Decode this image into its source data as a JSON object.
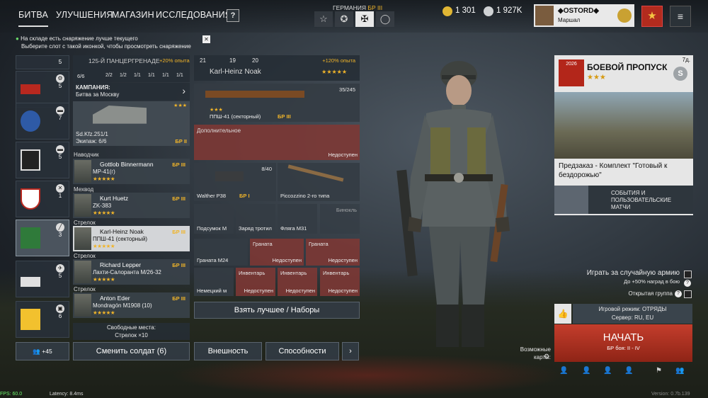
{
  "nav": {
    "tabs": [
      "БИТВА",
      "УЛУЧШЕНИЯ",
      "МАГАЗИН",
      "ИССЛЕДОВАНИЯ"
    ],
    "help": "?"
  },
  "nation": {
    "label": "ГЕРМАНИЯ",
    "br": "БР III",
    "buttons": [
      "☆",
      "✪",
      "✠",
      "◯"
    ]
  },
  "currency": {
    "gold": "1 301",
    "silver": "1 927K"
  },
  "profile": {
    "name": "◆OSTORD◆",
    "rank": "Маршал"
  },
  "notice": {
    "line1": "На складе есть снаряжение лучше текущего",
    "line2": "Выберите слот с такой иконкой, чтобы просмотреть снаряжение",
    "close": "✕"
  },
  "squads": [
    {
      "count": "5",
      "id": "s1"
    },
    {
      "count": "5",
      "id": "s2"
    },
    {
      "count": "7",
      "id": "s3"
    },
    {
      "count": "5",
      "id": "s4"
    },
    {
      "count": "1",
      "id": "s5"
    },
    {
      "count": "3",
      "id": "s6"
    },
    {
      "count": "5",
      "id": "s7"
    },
    {
      "count": "6",
      "id": "s8"
    }
  ],
  "squad_header": {
    "name": "125-Й ПАНЦЕРГРЕНАДЕ",
    "bonus": "+20% опыта",
    "size": "6/6",
    "stats": [
      "2/2",
      "1/2",
      "1/1",
      "1/1",
      "1/1",
      "1/1"
    ]
  },
  "campaign": {
    "label": "КАМПАНИЯ:",
    "value": "Битва за Москву"
  },
  "vehicle": {
    "name": "Sd.Kfz.251/1",
    "crew": "Экипаж: 6/6",
    "br": "БР II",
    "stars": "★★★"
  },
  "soldiers": [
    {
      "role": "Наводчик",
      "name": "Gottlob Binnermann",
      "weapon": "MP-41(г)",
      "br": "БР III",
      "stars": "★★★★★"
    },
    {
      "role": "Мехвод",
      "name": "Kurt Huetz",
      "weapon": "ZK-383",
      "br": "БР III",
      "stars": "★★★★★"
    },
    {
      "role": "Стрелок",
      "name": "Karl-Heinz Noak",
      "weapon": "ППШ-41 (секторный)",
      "br": "БР III",
      "stars": "★★★★★"
    },
    {
      "role": "Стрелок",
      "name": "Richard Lepper",
      "weapon": "Лахти-Салоранта М/26-32",
      "br": "БР III",
      "stars": "★★★★★"
    },
    {
      "role": "Стрелок",
      "name": "Anton Eder",
      "weapon": "Mondragón M1908 (10)",
      "br": "БР III",
      "stars": "★★★★★"
    }
  ],
  "free_slots": {
    "line1": "Свободные места:",
    "line2": "Стрелок ×10"
  },
  "squad_count": "+45",
  "change_soldier": "Сменить солдат (6)",
  "detail": {
    "stats": [
      "21",
      "19",
      "20"
    ],
    "bonus": "+120% опыта",
    "name": "Karl-Heinz Noak",
    "stars": "★★★★★"
  },
  "primary": {
    "name": "ППШ-41 (секторный)",
    "br": "БР III",
    "ammo": "35/245",
    "stars": "★★★"
  },
  "extra": {
    "label": "Дополнительное",
    "unavail": "Недоступен"
  },
  "sidearm": {
    "name": "Walther P38",
    "br": "БР I",
    "ammo": "8/40"
  },
  "melee": {
    "name": "Piccozzino 2-го типа"
  },
  "items": [
    {
      "name": "Подсумок М"
    },
    {
      "name": "Заряд тротил"
    },
    {
      "name": "Фляга M31"
    },
    {
      "name": "Бинокль"
    }
  ],
  "grenades": [
    {
      "name": "Граната M24"
    },
    {
      "name": "Граната",
      "unavail": "Недоступен"
    },
    {
      "name": "Граната",
      "unavail": "Недоступен"
    }
  ],
  "inventory": [
    {
      "name": "Немецкий м"
    },
    {
      "name": "Инвентарь",
      "unavail": "Недоступен"
    },
    {
      "name": "Инвентарь",
      "unavail": "Недоступен"
    },
    {
      "name": "Инвентарь",
      "unavail": "Недоступен"
    }
  ],
  "take_best": "Взять лучшее / Наборы",
  "appearance": "Внешность",
  "abilities": "Способности",
  "more": "›",
  "battlepass": {
    "title": "БОЕВОЙ ПРОПУСК",
    "stars": "★★★",
    "timer": "7д.",
    "badge": "2026",
    "offer": "Предзаказ - Комплект \"Готовый к бездорожью\"",
    "events": "СОБЫТИЯ И ПОЛЬЗОВАТЕЛЬСКИЕ МАТЧИ"
  },
  "random_army": {
    "label": "Играть за случайную армию",
    "sub": "До +50% наград в бою"
  },
  "open_group": "Открытая группа",
  "game_mode": {
    "mode": "Игровой режим: ОТРЯДЫ",
    "server": "Сервер: RU, EU"
  },
  "start": {
    "label": "НАЧАТЬ",
    "sub": "БР боя: II - IV"
  },
  "maps": {
    "label": "Возможные карты:",
    "icon": "⚙"
  },
  "footer": {
    "fps": "FPS: 60.0",
    "latency": "Latency: 8.4ms",
    "version": "Version: 0.7b.139"
  },
  "colors": {
    "accent": "#f0b429",
    "start": "#c43d2c",
    "unavail": "#7e3834"
  }
}
